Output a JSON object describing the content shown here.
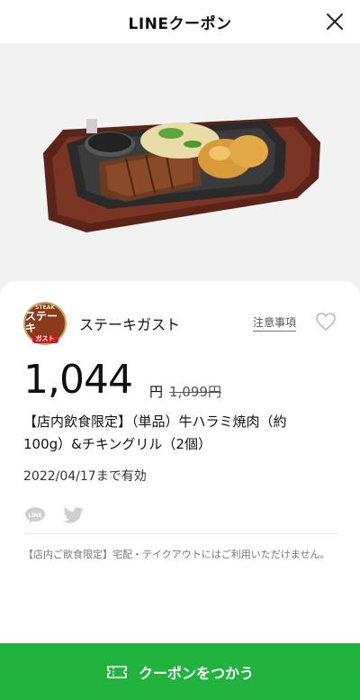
{
  "header": {
    "title": "LINEクーポン"
  },
  "shop": {
    "name": "ステーキガスト",
    "logo": {
      "top": "STEAK",
      "middle": "ステーキ",
      "bottom": "ガスト"
    },
    "notes_label": "注意事項"
  },
  "coupon": {
    "price": "1,044",
    "price_unit": "円",
    "original_price": "1,099円",
    "description": "【店内飲食限定】（単品）牛ハラミ焼肉（約100g）&チキングリル（2個）",
    "expiry": "2022/04/17まで有効",
    "note": "【店内ご飲食限定】宅配・テイクアウトにはご利用いただけません。"
  },
  "share": {
    "icons": [
      "line-icon",
      "twitter-icon"
    ]
  },
  "cta": {
    "label": "クーポンをつかう"
  },
  "colors": {
    "accent_green": "#22b33f",
    "logo_brown": "#8a3b1c"
  }
}
